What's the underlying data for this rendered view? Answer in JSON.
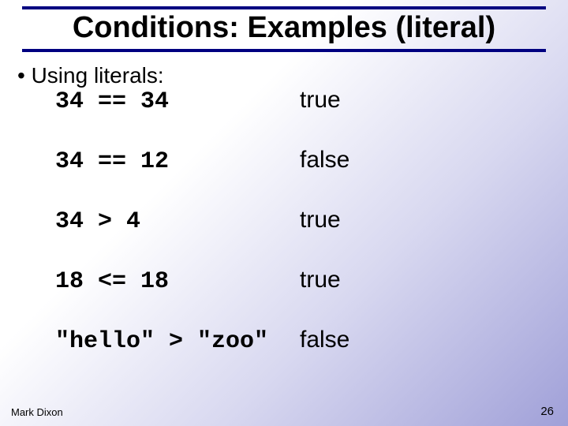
{
  "title": "Conditions: Examples (literal)",
  "bullet": "•  Using literals:",
  "examples": [
    {
      "expr": "34 == 34",
      "result": "true"
    },
    {
      "expr": "34 == 12",
      "result": "false"
    },
    {
      "expr": "34 > 4",
      "result": "true"
    },
    {
      "expr": "18 <= 18",
      "result": "true"
    },
    {
      "expr": "\"hello\" > \"zoo\"",
      "result": "false"
    }
  ],
  "footer": {
    "author": "Mark Dixon",
    "page": "26"
  }
}
